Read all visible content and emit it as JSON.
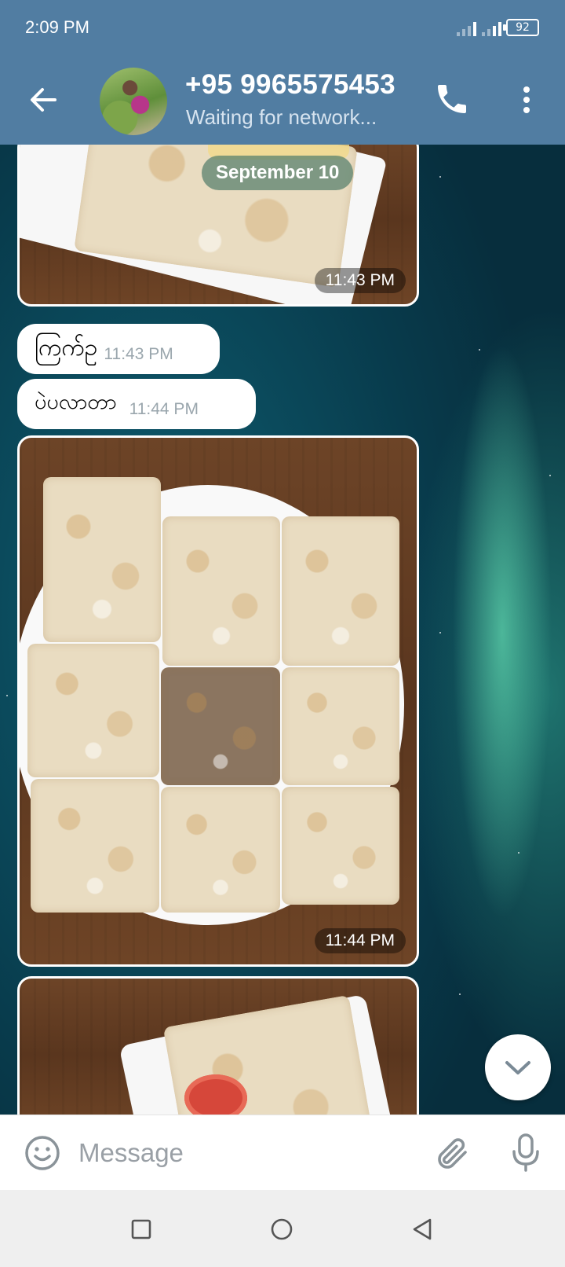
{
  "status_bar": {
    "time": "2:09 PM",
    "battery": "92"
  },
  "header": {
    "title": "+95 9965575453",
    "subtitle": "Waiting for network..."
  },
  "messages": {
    "date": "September 10",
    "photo1_time": "11:43 PM",
    "text1": {
      "text": "ကြက်ဥ",
      "time": "11:43 PM"
    },
    "text2": {
      "text": "ပဲပလာတာ",
      "time": "11:44 PM"
    },
    "photo2_time": "11:44 PM"
  },
  "input": {
    "placeholder": "Message"
  },
  "icons": {
    "back": "arrow-left-icon",
    "call": "phone-icon",
    "more": "more-vertical-icon",
    "emoji": "smiley-icon",
    "attach": "paperclip-icon",
    "mic": "microphone-icon",
    "scroll": "chevron-down-icon"
  },
  "colors": {
    "header": "#517da2",
    "bubble": "#ffffff"
  }
}
